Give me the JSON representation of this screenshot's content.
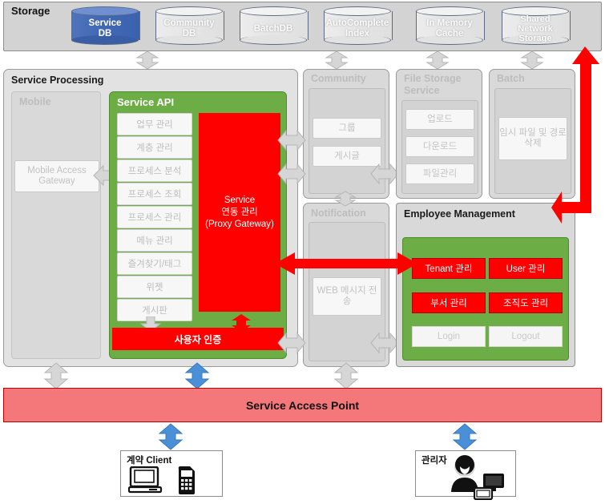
{
  "storage": {
    "title": "Storage",
    "databases": [
      {
        "name": "Service DB",
        "lines": [
          "Service",
          "DB"
        ],
        "style": "blue"
      },
      {
        "name": "Community DB",
        "lines": [
          "Community",
          "DB"
        ],
        "style": "gray"
      },
      {
        "name": "BatchDB",
        "lines": [
          "BatchDB"
        ],
        "style": "gray"
      },
      {
        "name": "AutoComplete Index",
        "lines": [
          "AutoComplete",
          "Index"
        ],
        "style": "gray"
      },
      {
        "name": "In Memory Cache",
        "lines": [
          "In Memory",
          "Cache"
        ],
        "style": "gray"
      },
      {
        "name": "Shared Network Storage",
        "lines": [
          "Shared",
          "Network",
          "Storage"
        ],
        "style": "gray"
      }
    ]
  },
  "service_processing": {
    "title": "Service Processing",
    "mobile": {
      "title": "Mobile",
      "gateway_label": "Mobile Access Gateway"
    },
    "service_api": {
      "title": "Service API",
      "items": [
        "업무 관리",
        "계층 관리",
        "프로세스 분석",
        "프로세스 조회",
        "프로세스 관리",
        "메뉴 관리",
        "즐겨찾기/태그",
        "위젯",
        "게시판"
      ],
      "proxy": {
        "line1": "Service",
        "line2": "연동 관리",
        "line3": "(Proxy Gateway)"
      },
      "auth_bar": "사용자 인증"
    }
  },
  "community": {
    "title": "Community",
    "items": [
      "그룹",
      "게시글"
    ]
  },
  "file_storage": {
    "title": "File Storage Service",
    "items": [
      "업로드",
      "다운로드",
      "파일관리"
    ]
  },
  "batch": {
    "title": "Batch",
    "items": [
      "임시 파일 및 경로 삭제"
    ]
  },
  "notification": {
    "title": "Notification",
    "items": [
      "WEB 메시지 전송"
    ]
  },
  "employee_management": {
    "title": "Employee Management",
    "primary_buttons": [
      "Tenant 관리",
      "User 관리",
      "부서 관리",
      "조직도 관리"
    ],
    "secondary_buttons": [
      "Login",
      "Logout"
    ]
  },
  "service_access_point": {
    "label": "Service Access Point"
  },
  "actors": [
    {
      "label": "계약 Client",
      "icons": [
        "desktop-computer-icon",
        "mobile-phone-icon"
      ]
    },
    {
      "label": "관리자",
      "icons": [
        "admin-person-icon",
        "monitor-icon"
      ]
    }
  ],
  "colors": {
    "accent_green": "#6cae45",
    "accent_red": "#ff0000",
    "service_db_blue": "#4068b4",
    "access_point_pink": "#f4777a",
    "panel_gray": "#d9d9d9",
    "arrow_gray": "#d4d4d4",
    "arrow_blue": "#4a90d9"
  }
}
